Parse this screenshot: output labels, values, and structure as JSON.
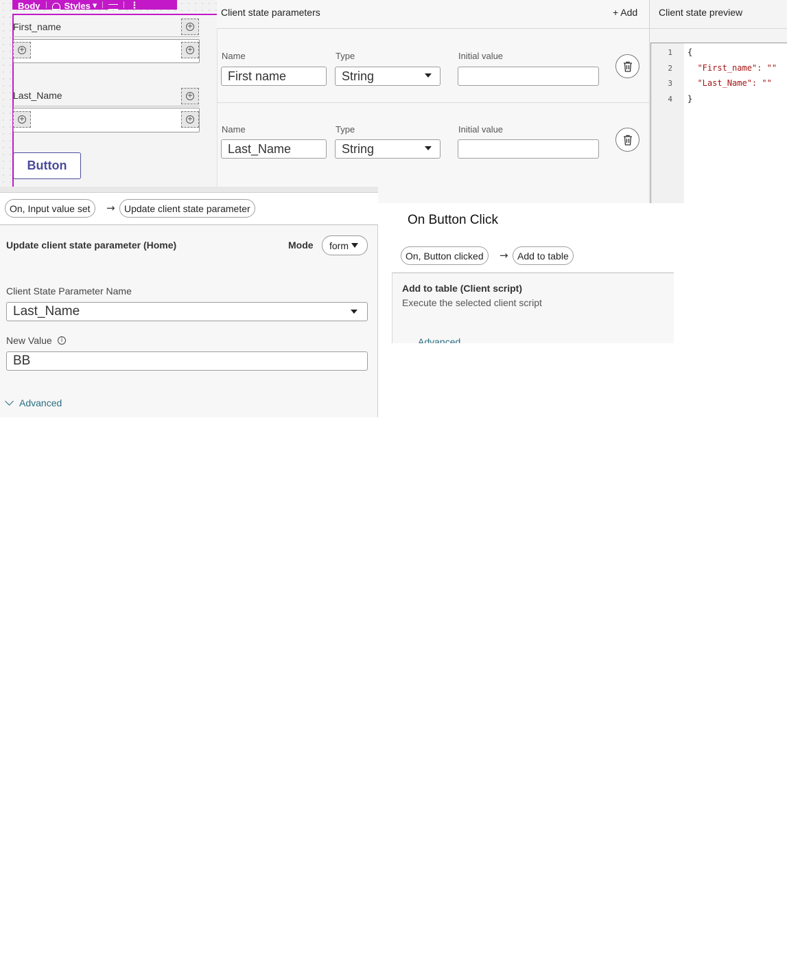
{
  "canvas": {
    "toolbar": {
      "body_label": "Body",
      "styles_label": "Styles",
      "styles_caret": "▾",
      "more_label": "⋮"
    },
    "fields": [
      {
        "label": "First_name"
      },
      {
        "label": "Last_Name"
      }
    ],
    "button_label": "Button"
  },
  "client_state_parameters": {
    "title": "Client state parameters",
    "add_label": "+ Add",
    "columns": {
      "name": "Name",
      "type": "Type",
      "initial_value": "Initial value"
    },
    "rows": [
      {
        "name": "First name",
        "type": "String",
        "initial_value": ""
      },
      {
        "name": "Last_Name",
        "type": "String",
        "initial_value": ""
      }
    ]
  },
  "client_state_preview": {
    "title": "Client state preview",
    "line_numbers": [
      "1",
      "2",
      "3",
      "4"
    ],
    "lines": [
      "{",
      "  \"First_name\": \"\"",
      "  \"Last_Name\": \"\"",
      "}"
    ]
  },
  "update_panel": {
    "trigger_pill": "On, Input value set",
    "arrow": "→",
    "action_pill": "Update client state parameter",
    "title": "Update client state parameter (Home)",
    "mode_label": "Mode",
    "mode_value": "form",
    "param_name_label": "Client State Parameter Name",
    "param_name_value": "Last_Name",
    "new_value_label": "New Value",
    "new_value_value": "BB",
    "advanced_label": "Advanced"
  },
  "button_click_panel": {
    "title": "On Button Click",
    "trigger_pill": "On, Button clicked",
    "arrow": "→",
    "action_pill": "Add to table",
    "action_title": "Add to table (Client script)",
    "action_desc": "Execute the selected client script",
    "advanced_label": "Advanced"
  },
  "colors": {
    "accent_magenta": "#c218c8",
    "button_text": "#4b4b9b",
    "link_teal": "#2b6f83"
  }
}
